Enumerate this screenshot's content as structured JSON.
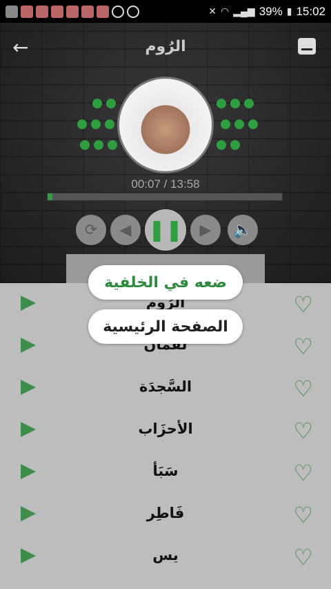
{
  "statusbar": {
    "battery": "39%",
    "time": "15:02"
  },
  "header": {
    "title": "الرُوم"
  },
  "player": {
    "elapsed": "00:07 / 13:58",
    "progress": 0.02
  },
  "popup": {
    "background_label": "ضعه في الخلفية",
    "home_label": "الصفحة الرئيسية"
  },
  "suras": [
    "الرُوم",
    "لُقمَان",
    "السَّجدَة",
    "الأحزَاب",
    "سَبَأ",
    "فَاطِر",
    "يس"
  ],
  "colors": {
    "accent": "#2e9e3e",
    "list_bg": "#bdbdbd"
  }
}
